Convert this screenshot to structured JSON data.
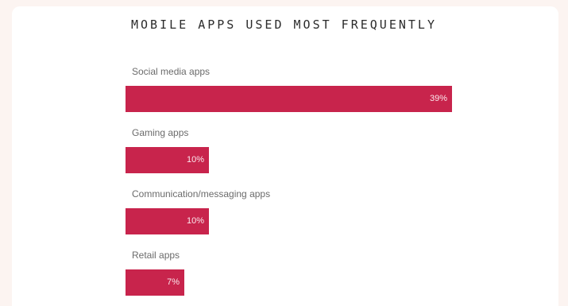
{
  "chart_data": {
    "type": "bar",
    "orientation": "horizontal",
    "title": "MOBILE APPS USED MOST FREQUENTLY",
    "categories": [
      "Social media apps",
      "Gaming apps",
      "Communication/messaging apps",
      "Retail apps"
    ],
    "values": [
      39,
      10,
      10,
      7
    ],
    "value_labels": [
      "39%",
      "10%",
      "10%",
      "7%"
    ],
    "unit": "%",
    "xlim": [
      0,
      39
    ],
    "grid": false,
    "legend": "none",
    "bar_color": "#c8244c"
  }
}
